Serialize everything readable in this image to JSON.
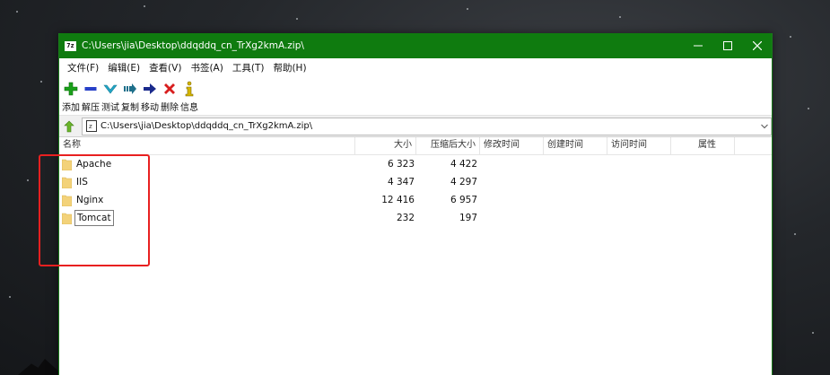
{
  "window": {
    "app_icon_text": "7z",
    "title": "C:\\Users\\jia\\Desktop\\ddqddq_cn_TrXg2kmA.zip\\"
  },
  "menu": [
    {
      "label": "文件(F)"
    },
    {
      "label": "编辑(E)"
    },
    {
      "label": "查看(V)"
    },
    {
      "label": "书签(A)"
    },
    {
      "label": "工具(T)"
    },
    {
      "label": "帮助(H)"
    }
  ],
  "toolbar": [
    {
      "label": "添加",
      "icon": "add-icon",
      "color": "#1aa01a"
    },
    {
      "label": "解压",
      "icon": "extract-icon",
      "color": "#2740c8"
    },
    {
      "label": "测试",
      "icon": "test-icon",
      "color": "#23a6c6"
    },
    {
      "label": "复制",
      "icon": "copy-icon",
      "color": "#1e6f8a"
    },
    {
      "label": "移动",
      "icon": "move-icon",
      "color": "#1a2a8c"
    },
    {
      "label": "删除",
      "icon": "delete-icon",
      "color": "#d81e1e"
    },
    {
      "label": "信息",
      "icon": "info-icon",
      "color": "#d6b600"
    }
  ],
  "address": {
    "path": "C:\\Users\\jia\\Desktop\\ddqddq_cn_TrXg2kmA.zip\\"
  },
  "columns": {
    "name": "名称",
    "size": "大小",
    "packed": "压缩后大小",
    "modified": "修改时间",
    "created": "创建时间",
    "accessed": "访问时间",
    "attributes": "属性"
  },
  "files": [
    {
      "name": "Apache",
      "size": "6 323",
      "packed": "4 422"
    },
    {
      "name": "IIS",
      "size": "4 347",
      "packed": "4 297"
    },
    {
      "name": "Nginx",
      "size": "12 416",
      "packed": "6 957"
    },
    {
      "name": "Tomcat",
      "size": "232",
      "packed": "197"
    }
  ],
  "colors": {
    "titlebar": "#0f7b0f",
    "annotation": "#e82020",
    "folder": "#f3d27a"
  }
}
